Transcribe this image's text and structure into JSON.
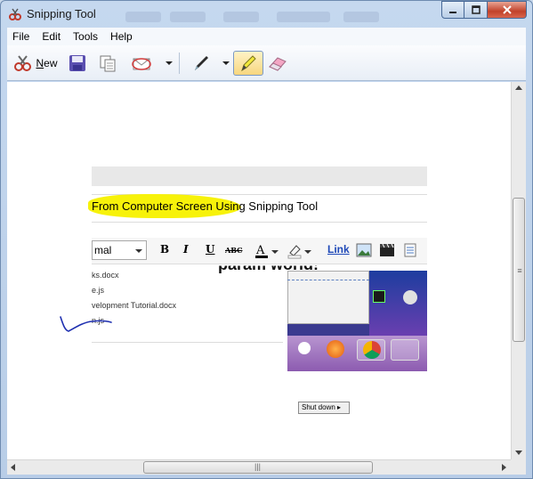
{
  "window": {
    "title": "Snipping Tool"
  },
  "menu": [
    "File",
    "Edit",
    "Tools",
    "Help"
  ],
  "toolbar": {
    "new_label_underline": "N",
    "new_label_rest": "ew"
  },
  "snip": {
    "heading_highlighted": "From Computer Screen Using",
    "heading_rest": " Snipping Tool",
    "font_select": "mal",
    "format_buttons": [
      "B",
      "I",
      "U",
      "ABC"
    ],
    "link_label": "Link",
    "file_lines": [
      "ks.docx",
      "e.js",
      "velopment Tutorial.docx",
      "n.js"
    ],
    "overlay_text": "param world!",
    "shutdown_label": "Shut down"
  },
  "colors": {
    "highlighter": "#f7f20a",
    "pen_ink": "#1e2fb0",
    "link": "#1f49b8"
  }
}
